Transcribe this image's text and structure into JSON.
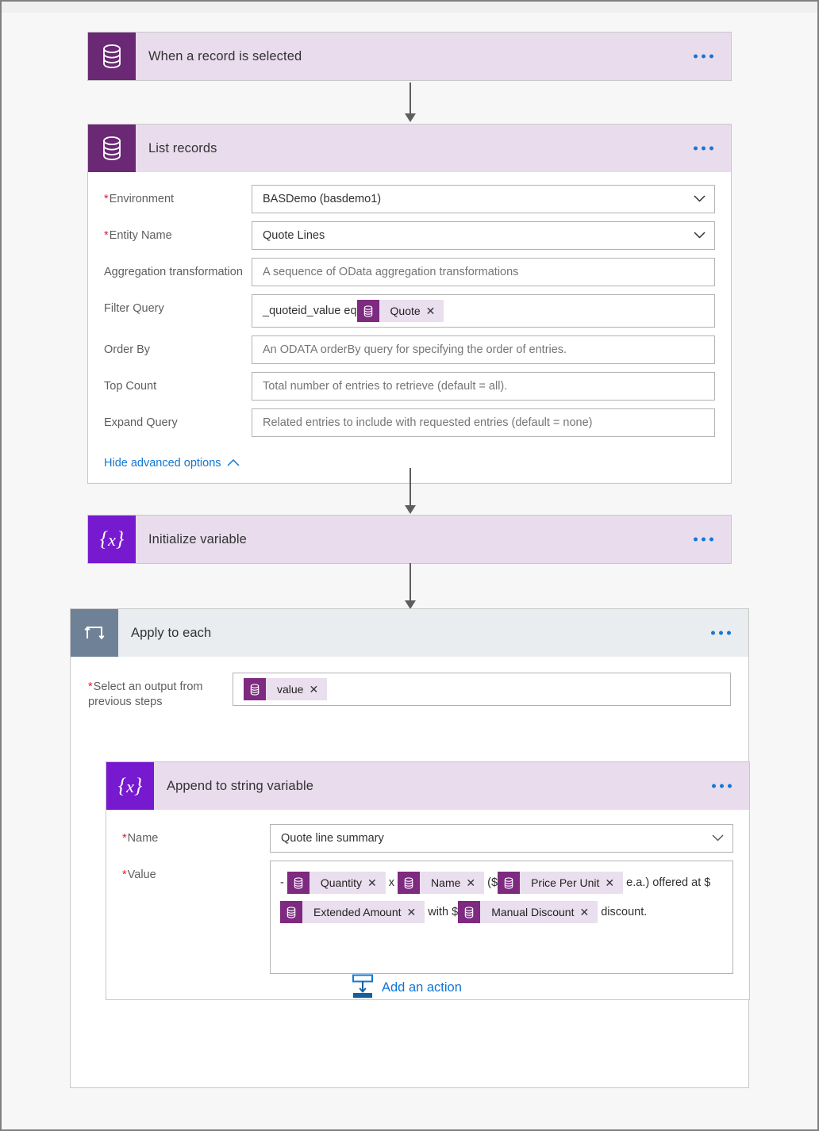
{
  "flow": {
    "trigger": {
      "title": "When a record is selected",
      "icon": "database-icon",
      "menu": "more-options"
    },
    "list_records": {
      "title": "List records",
      "icon": "database-icon",
      "fields": [
        {
          "label": "Environment",
          "required": true,
          "type": "dropdown",
          "value": "BASDemo (basdemo1)",
          "placeholder": ""
        },
        {
          "label": "Entity Name",
          "required": true,
          "type": "dropdown",
          "value": "Quote Lines",
          "placeholder": ""
        },
        {
          "label": "Aggregation transformation",
          "required": false,
          "type": "text",
          "value": "",
          "placeholder": "A sequence of OData aggregation transformations"
        },
        {
          "label": "Filter Query",
          "required": false,
          "type": "tokens",
          "value": "",
          "placeholder": ""
        },
        {
          "label": "Order By",
          "required": false,
          "type": "text",
          "value": "",
          "placeholder": "An ODATA orderBy query for specifying the order of entries."
        },
        {
          "label": "Top Count",
          "required": false,
          "type": "text",
          "value": "",
          "placeholder": "Total number of entries to retrieve (default = all)."
        },
        {
          "label": "Expand Query",
          "required": false,
          "type": "text",
          "value": "",
          "placeholder": "Related entries to include with requested entries (default = none)"
        }
      ],
      "filter_query": {
        "prefix": "_quoteid_value eq ",
        "token": "Quote",
        "token_remove": "✕"
      },
      "advanced_link": "Hide advanced options"
    },
    "initialize_variable": {
      "title": "Initialize variable",
      "icon": "variable-icon"
    },
    "apply_to_each": {
      "title": "Apply to each",
      "icon": "loop-icon",
      "select_output": {
        "label": "Select an output from previous steps",
        "required": true,
        "token": "value",
        "token_remove": "✕"
      },
      "append_to_string": {
        "title": "Append to string variable",
        "icon": "variable-icon",
        "name_field": {
          "label": "Name",
          "required": true,
          "value": "Quote line summary"
        },
        "value_field": {
          "label": "Value",
          "required": true,
          "parts": [
            {
              "kind": "text",
              "text": "- "
            },
            {
              "kind": "token",
              "text": "Quantity",
              "remove": "✕"
            },
            {
              "kind": "text",
              "text": " x "
            },
            {
              "kind": "token",
              "text": "Name",
              "remove": "✕"
            },
            {
              "kind": "text",
              "text": " ($"
            },
            {
              "kind": "token",
              "text": "Price Per Unit",
              "remove": "✕"
            },
            {
              "kind": "text",
              "text": " e.a.) "
            },
            {
              "kind": "text",
              "text": "offered at $"
            },
            {
              "kind": "token",
              "text": "Extended Amount",
              "remove": "✕"
            },
            {
              "kind": "text",
              "text": " with $"
            },
            {
              "kind": "token",
              "text": "Manual Discount",
              "remove": "✕"
            },
            {
              "kind": "text",
              "text": " discount."
            }
          ]
        }
      },
      "add_action": "Add an action"
    }
  },
  "colors": {
    "cds_icon_bg": "#6a2875",
    "variable_icon_bg": "#7719cf",
    "loop_icon_bg": "#6f8196",
    "card_header_bg": "#e8dced",
    "loop_header_bg": "#e9edf0",
    "token_bg": "#eadfee",
    "token_icon_bg": "#7d2a80",
    "link_blue": "#0f76d4",
    "required_red": "#e31837",
    "connector_gray": "#605e5c"
  }
}
